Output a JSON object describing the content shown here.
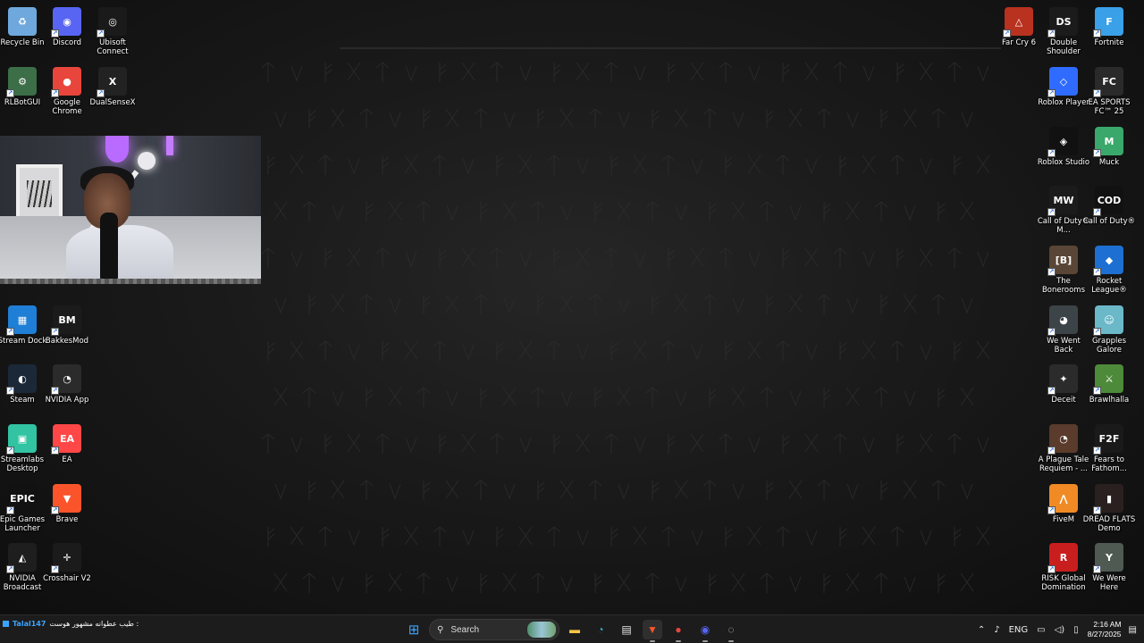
{
  "desktop": {
    "left_icons": [
      {
        "label": "Recycle Bin",
        "icon": "recycle-bin-icon",
        "color": "#6fa8dc",
        "glyph": "♻"
      },
      {
        "label": "Discord",
        "icon": "discord-icon",
        "color": "#5865f2",
        "glyph": "◉"
      },
      {
        "label": "Ubisoft Connect",
        "icon": "ubisoft-icon",
        "color": "#1a1a1a",
        "glyph": "◎"
      },
      {
        "label": "RLBotGUI",
        "icon": "rlbot-icon",
        "color": "#3c6e47",
        "glyph": "⚙"
      },
      {
        "label": "Google Chrome",
        "icon": "chrome-icon",
        "color": "#e8453c",
        "glyph": "●"
      },
      {
        "label": "DualSenseX",
        "icon": "dualsensex-icon",
        "color": "#222222",
        "glyph": "X"
      },
      {
        "label": "Stream Dock",
        "icon": "stream-dock-icon",
        "color": "#1f7fd6",
        "glyph": "▦"
      },
      {
        "label": "BakkesMod",
        "icon": "bakkesmod-icon",
        "color": "#1b1b1b",
        "glyph": "BM"
      },
      {
        "label": "Steam",
        "icon": "steam-icon",
        "color": "#1b2838",
        "glyph": "◐"
      },
      {
        "label": "NVIDIA App",
        "icon": "nvidia-app-icon",
        "color": "#2b2b2b",
        "glyph": "◔"
      },
      {
        "label": "Streamlabs Desktop",
        "icon": "streamlabs-icon",
        "color": "#31c3a2",
        "glyph": "▣"
      },
      {
        "label": "EA",
        "icon": "ea-icon",
        "color": "#ff4747",
        "glyph": "EA"
      },
      {
        "label": "Epic Games Launcher",
        "icon": "epic-games-icon",
        "color": "#111111",
        "glyph": "EPIC"
      },
      {
        "label": "Brave",
        "icon": "brave-icon",
        "color": "#fb542b",
        "glyph": "▼"
      },
      {
        "label": "NVIDIA Broadcast",
        "icon": "nvidia-broadcast-icon",
        "color": "#1e1e1e",
        "glyph": "◭"
      },
      {
        "label": "Crosshair V2",
        "icon": "crosshair-icon",
        "color": "#1b1b1b",
        "glyph": "✛"
      }
    ],
    "right_icons": [
      {
        "label": "Far Cry 6",
        "icon": "far-cry-icon",
        "color": "#b8321f",
        "glyph": "△"
      },
      {
        "label": "Double Shoulder",
        "icon": "double-shoulder-icon",
        "color": "#1b1b1b",
        "glyph": "DS"
      },
      {
        "label": "Fortnite",
        "icon": "fortnite-icon",
        "color": "#3aa0e8",
        "glyph": "F"
      },
      {
        "label": "Roblox Player",
        "icon": "roblox-icon",
        "color": "#2f6bff",
        "glyph": "◇"
      },
      {
        "label": "EA SPORTS FC™ 25",
        "icon": "ea-fc-icon",
        "color": "#2a2a2a",
        "glyph": "FC"
      },
      {
        "label": "Roblox Studio",
        "icon": "roblox-studio-icon",
        "color": "#111111",
        "glyph": "◈"
      },
      {
        "label": "Muck",
        "icon": "muck-icon",
        "color": "#3aa86b",
        "glyph": "M"
      },
      {
        "label": "Call of Duty® M...",
        "icon": "mw3-icon",
        "color": "#1b1b1b",
        "glyph": "MW"
      },
      {
        "label": "Call of Duty®",
        "icon": "call-of-duty-icon",
        "color": "#111111",
        "glyph": "COD"
      },
      {
        "label": "The Bonerooms",
        "icon": "bonerooms-icon",
        "color": "#5a4636",
        "glyph": "[B]"
      },
      {
        "label": "Rocket League®",
        "icon": "rocket-league-icon",
        "color": "#1d6fd1",
        "glyph": "◆"
      },
      {
        "label": "We Went Back",
        "icon": "we-went-back-icon",
        "color": "#3d4448",
        "glyph": "◕"
      },
      {
        "label": "Grapples Galore",
        "icon": "grapples-galore-icon",
        "color": "#6bb8c9",
        "glyph": "☺"
      },
      {
        "label": "Deceit",
        "icon": "deceit-icon",
        "color": "#2b2b2b",
        "glyph": "✦"
      },
      {
        "label": "Brawlhalla",
        "icon": "brawlhalla-icon",
        "color": "#4d8a3a",
        "glyph": "⚔"
      },
      {
        "label": "A Plague Tale Requiem - ...",
        "icon": "plague-tale-icon",
        "color": "#5a3b2c",
        "glyph": "◔"
      },
      {
        "label": "Fears to Fathom...",
        "icon": "fears-to-fathom-icon",
        "color": "#1a1a1a",
        "glyph": "F2F"
      },
      {
        "label": "FiveM",
        "icon": "fivem-icon",
        "color": "#f08a24",
        "glyph": "⋀"
      },
      {
        "label": "DREAD FLATS Demo",
        "icon": "dread-flats-icon",
        "color": "#2b2020",
        "glyph": "▮"
      },
      {
        "label": "RISK Global Domination",
        "icon": "risk-icon",
        "color": "#c81e1e",
        "glyph": "R"
      },
      {
        "label": "We Were Here",
        "icon": "we-were-here-icon",
        "color": "#4e5a52",
        "glyph": "Y"
      }
    ]
  },
  "chat": {
    "user": "Talal147",
    "message": "طيب عطوانه مشهور هوست :"
  },
  "taskbar": {
    "search_placeholder": "Search",
    "apps": [
      {
        "name": "start-button",
        "icon": "windows-start-icon",
        "glyph": "⊞",
        "color": "#3ea6ff"
      },
      {
        "name": "file-explorer",
        "icon": "folder-icon",
        "glyph": "▬",
        "color": "#f6c344"
      },
      {
        "name": "edge",
        "icon": "edge-icon",
        "glyph": "◔",
        "color": "#2fb6d6"
      },
      {
        "name": "store",
        "icon": "store-icon",
        "glyph": "▤",
        "color": "#e8e8e8"
      },
      {
        "name": "brave",
        "icon": "brave-icon",
        "glyph": "▼",
        "color": "#fb542b"
      },
      {
        "name": "chrome",
        "icon": "chrome-icon",
        "glyph": "●",
        "color": "#e8453c"
      },
      {
        "name": "discord",
        "icon": "discord-icon",
        "glyph": "◉",
        "color": "#5865f2"
      },
      {
        "name": "obs-streamlabs",
        "icon": "streamlabs-icon",
        "glyph": "◌",
        "color": "#cccccc"
      }
    ],
    "tray": {
      "language": "ENG",
      "time": "2:16 AM",
      "date": "8/27/2025"
    }
  }
}
